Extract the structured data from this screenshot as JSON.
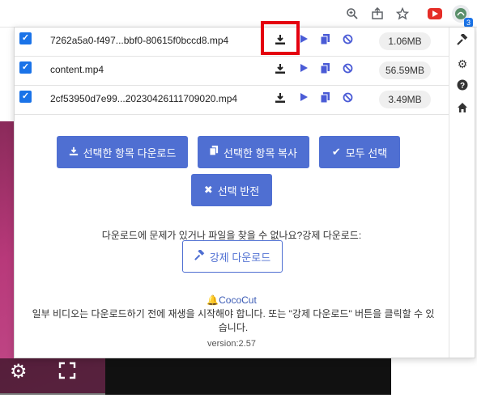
{
  "toolbar": {
    "icons": [
      "zoom-icon",
      "share-icon",
      "bookmark-star-icon",
      "youtube-extension-icon",
      "cococut-extension-icon"
    ],
    "extension_badge": "3"
  },
  "files": [
    {
      "name": "7262a5a0-f497...bbf0-80615f0bccd8.mp4",
      "size": "1.06MB",
      "checked": true
    },
    {
      "name": "content.mp4",
      "size": "56.59MB",
      "checked": false
    },
    {
      "name": "2cf53950d7e99...20230426111709020.mp4",
      "size": "3.49MB",
      "checked": true
    }
  ],
  "buttons": {
    "download_selected": "선택한 항목 다운로드",
    "copy_selected": "선택한 항목 복사",
    "select_all": "모두 선택",
    "invert_selection": "선택 반전"
  },
  "force": {
    "message": "다운로드에 문제가 있거나 파일을 찾을 수 없나요?강제 다운로드:",
    "button": "강제 다운로드"
  },
  "footer": {
    "brand": "CocoCut",
    "note": "일부 비디오는 다운로드하기 전에 재생을 시작해야 합니다. 또는 \"강제 다운로드\" 버튼을 클릭할 수 있습니다.",
    "version": "version:2.57"
  },
  "colors": {
    "accent": "#4f6fd2",
    "checkbox": "#1a73e8",
    "highlight": "#e4000f",
    "video_pink": "#b8397a"
  }
}
